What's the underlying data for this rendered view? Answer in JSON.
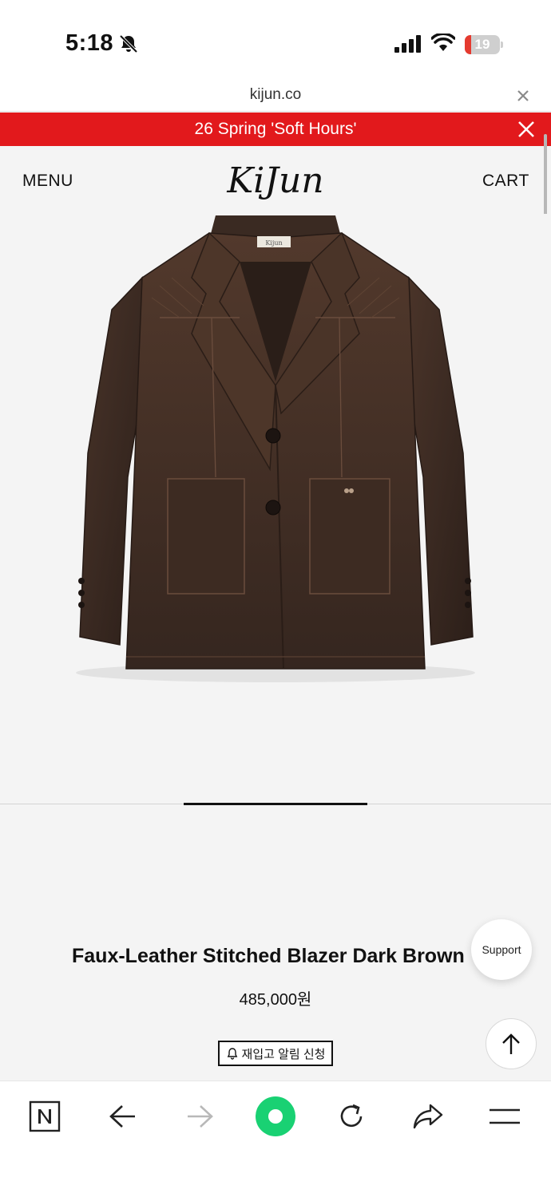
{
  "status_bar": {
    "time": "5:18",
    "battery_level": "19",
    "battery_fraction": 0.19,
    "icons": [
      "bell-slash-icon",
      "cellular-signal-icon",
      "wifi-icon",
      "battery-icon"
    ]
  },
  "browser": {
    "url": "kijun.co",
    "close_icon": "close-icon"
  },
  "banner": {
    "text": "26 Spring 'Soft Hours'",
    "background": "#e2191c"
  },
  "header": {
    "menu_label": "MENU",
    "logo": "KiJun",
    "cart_label": "CART"
  },
  "gallery": {
    "image": "dark-brown-faux-leather-blazer",
    "current_index": 2,
    "total": 3
  },
  "product": {
    "name": "Faux-Leather Stitched Blazer Dark Brown",
    "price": "485,000원",
    "restock_button": "재입고 알림 신청"
  },
  "floating": {
    "support_label": "Support",
    "top_icon": "arrow-up-icon"
  },
  "bottom_bar": {
    "icons": [
      "naver-n-icon",
      "back-arrow-icon",
      "forward-arrow-icon",
      "green-dot-icon",
      "reload-icon",
      "share-icon",
      "hamburger-menu-icon"
    ]
  }
}
